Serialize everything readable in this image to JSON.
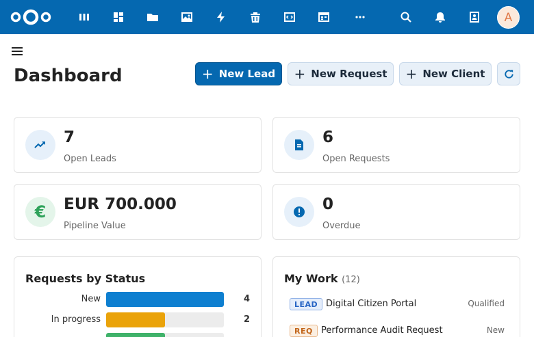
{
  "header": {
    "avatar_initial": "A",
    "nav_icons": [
      "dashboard-icon",
      "grid-icon",
      "folder-icon",
      "image-icon",
      "activity-icon",
      "trash-icon",
      "code-icon",
      "calendar-table-icon",
      "more-icon"
    ],
    "right_icons": [
      "search-icon",
      "bell-icon",
      "contacts-icon"
    ]
  },
  "page": {
    "title": "Dashboard"
  },
  "actions": {
    "new_lead": "New Lead",
    "new_request": "New Request",
    "new_client": "New Client"
  },
  "stats": {
    "open_leads": {
      "value": "7",
      "label": "Open Leads"
    },
    "open_requests": {
      "value": "6",
      "label": "Open Requests"
    },
    "pipeline": {
      "value": "EUR 700.000",
      "label": "Pipeline Value"
    },
    "overdue": {
      "value": "0",
      "label": "Overdue"
    }
  },
  "requests_by_status": {
    "title": "Requests by Status",
    "rows": [
      {
        "label": "New",
        "count": "4",
        "value": 4,
        "color": "#0e7fd0"
      },
      {
        "label": "In progress",
        "count": "2",
        "value": 2,
        "color": "#eaa30a"
      },
      {
        "label": "",
        "count": "",
        "value": 2,
        "color": "#3fb26a"
      }
    ],
    "max": 4
  },
  "my_work": {
    "title": "My Work",
    "count": "(12)",
    "items": [
      {
        "tag": "LEAD",
        "title": "Digital Citizen Portal",
        "status": "Qualified"
      },
      {
        "tag": "REQ",
        "title": "Performance Audit Request",
        "status": "New"
      }
    ]
  },
  "colors": {
    "brand": "#0568b0",
    "leads_icon_bg": "#e6f0fa",
    "pipeline_icon_bg": "#e4f5ea",
    "pipeline_icon": "#2ea25a"
  }
}
